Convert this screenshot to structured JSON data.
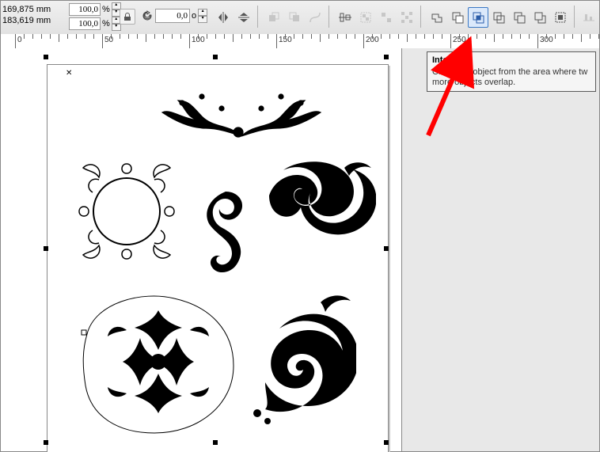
{
  "coords": {
    "x": "169,875 mm",
    "y": "183,619 mm"
  },
  "scale": {
    "x": "100,0",
    "y": "100,0",
    "unit": "%"
  },
  "rotation": {
    "value": "0,0",
    "unit": "o"
  },
  "ruler": {
    "labels": [
      {
        "pos": 18,
        "text": "0"
      },
      {
        "pos": 128,
        "text": "50"
      },
      {
        "pos": 238,
        "text": "100"
      },
      {
        "pos": 348,
        "text": "150"
      },
      {
        "pos": 458,
        "text": "200"
      },
      {
        "pos": 568,
        "text": "250"
      },
      {
        "pos": 678,
        "text": "300"
      }
    ]
  },
  "tooltip": {
    "title": "Intersect",
    "body1": "Create an object from the area where tw",
    "body2": "more objects overlap."
  },
  "toolbar": {
    "mirror_h": "mirror-horizontal-icon",
    "mirror_v": "mirror-vertical-icon",
    "to_front": "to-front-icon",
    "to_back": "to-back-icon",
    "convert_curves": "convert-to-curves-icon",
    "align": "align-distribute-icon",
    "group": "group-icon",
    "ungroup": "ungroup-icon",
    "ungroup_all": "ungroup-all-icon",
    "weld": "weld-icon",
    "trim": "trim-icon",
    "intersect": "intersect-icon",
    "simplify": "simplify-icon",
    "front_minus_back": "front-minus-back-icon",
    "back_minus_front": "back-minus-front-icon",
    "boundary": "create-boundary-icon",
    "align_baseline": "align-baseline-icon"
  }
}
